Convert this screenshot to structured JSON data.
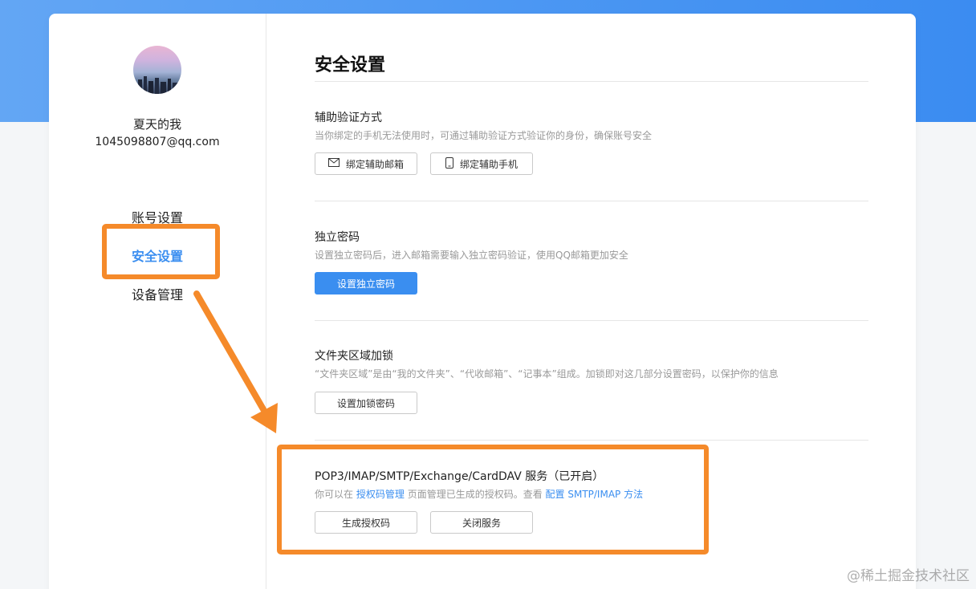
{
  "user": {
    "name": "夏天的我",
    "email": "1045098807@qq.com"
  },
  "nav": {
    "items": [
      {
        "label": "账号设置"
      },
      {
        "label": "安全设置"
      },
      {
        "label": "设备管理"
      }
    ],
    "active": 1
  },
  "main": {
    "title": "安全设置",
    "sections": [
      {
        "title": "辅助验证方式",
        "desc": "当你绑定的手机无法使用时，可通过辅助验证方式验证你的身份，确保账号安全",
        "buttons": [
          {
            "label": "绑定辅助邮箱",
            "icon": "mail-icon"
          },
          {
            "label": "绑定辅助手机",
            "icon": "phone-icon"
          }
        ]
      },
      {
        "title": "独立密码",
        "desc": "设置独立密码后，进入邮箱需要输入独立密码验证，使用QQ邮箱更加安全",
        "buttons": [
          {
            "label": "设置独立密码",
            "primary": true
          }
        ]
      },
      {
        "title": "文件夹区域加锁",
        "desc": "“文件夹区域”是由“我的文件夹”、“代收邮箱”、“记事本”组成。加锁即对这几部分设置密码，以保护你的信息",
        "buttons": [
          {
            "label": "设置加锁密码"
          }
        ]
      },
      {
        "title": "POP3/IMAP/SMTP/Exchange/CardDAV 服务（已开启）",
        "desc_prefix": "你可以在",
        "desc_link1": "授权码管理",
        "desc_middle": "页面管理已生成的授权码。查看",
        "desc_link2": "配置 SMTP/IMAP 方法",
        "buttons": [
          {
            "label": "生成授权码"
          },
          {
            "label": "关闭服务"
          }
        ]
      }
    ]
  },
  "watermark": "@稀土掘金技术社区",
  "colors": {
    "accent": "#3a8ef0",
    "highlight": "#f58a2a",
    "banner": "#4d98f3"
  }
}
